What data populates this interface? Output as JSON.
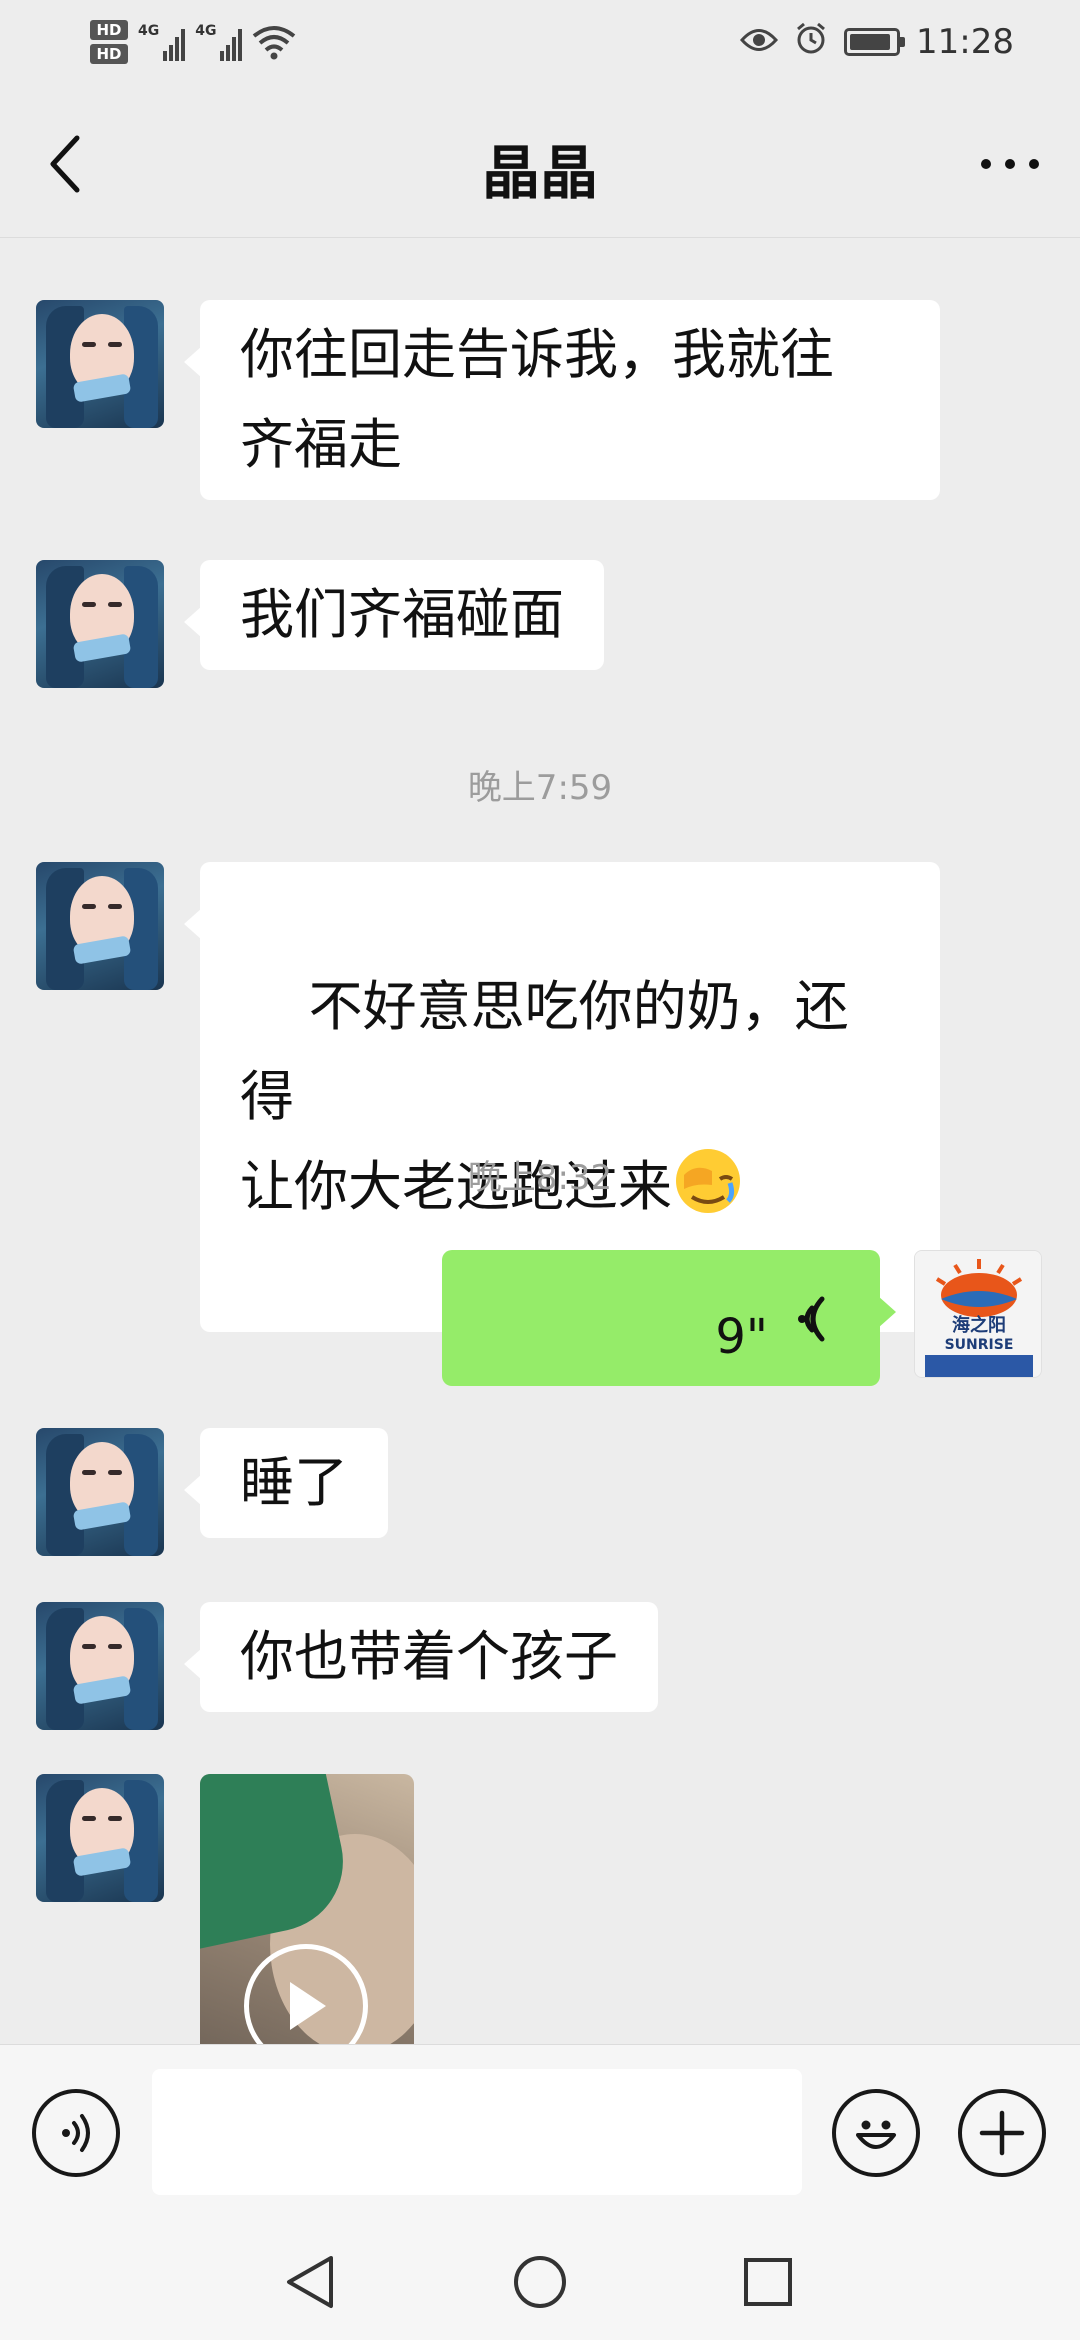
{
  "status_bar": {
    "hd1": "HD",
    "hd2": "HD",
    "net1": "4G",
    "net2": "4G",
    "time": "11:28",
    "battery_level": 0.9
  },
  "header": {
    "title": "晶晶"
  },
  "messages": {
    "m1": "你往回走告诉我，我就往\n齐福走",
    "m2": "我们齐福碰面",
    "time1": "晚上7:59",
    "m3": "不好意思吃你的奶，还得\n让你大老远跑过来",
    "time2": "晚上8:32",
    "voice_duration": "9\"",
    "m4": "睡了",
    "m5": "你也带着个孩子"
  },
  "my_avatar": {
    "brand_cn": "海之阳",
    "brand_en": "SUNRISE"
  },
  "input": {
    "placeholder": ""
  },
  "icons": {
    "back": "chevron-left-icon",
    "more": "more-dots-icon",
    "voice_toggle": "voice-icon",
    "emoji": "smiley-icon",
    "plus": "plus-icon",
    "nav_back": "triangle-back-icon",
    "nav_home": "circle-home-icon",
    "nav_recent": "square-recent-icon"
  }
}
